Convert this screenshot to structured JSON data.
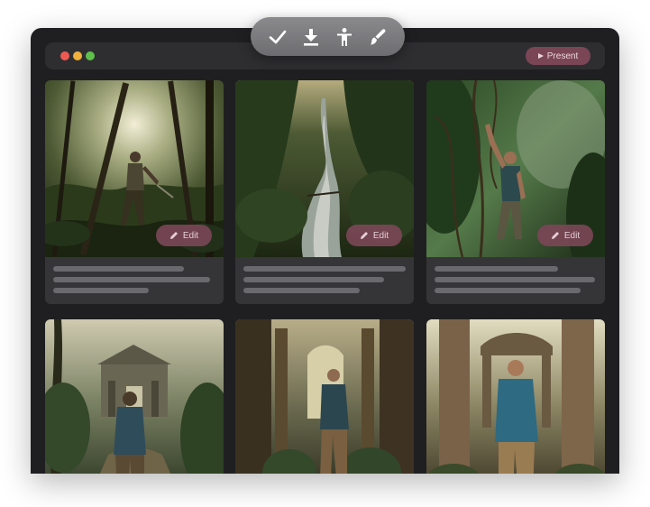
{
  "window": {
    "present_label": "Present"
  },
  "toolbar": {
    "tools": [
      "check-icon",
      "download-icon",
      "figure-icon",
      "brush-icon"
    ]
  },
  "cards": [
    {
      "edit_label": "Edit"
    },
    {
      "edit_label": "Edit"
    },
    {
      "edit_label": "Edit"
    }
  ],
  "colors": {
    "window_bg": "#1f1f21",
    "accent": "#7a4656"
  }
}
